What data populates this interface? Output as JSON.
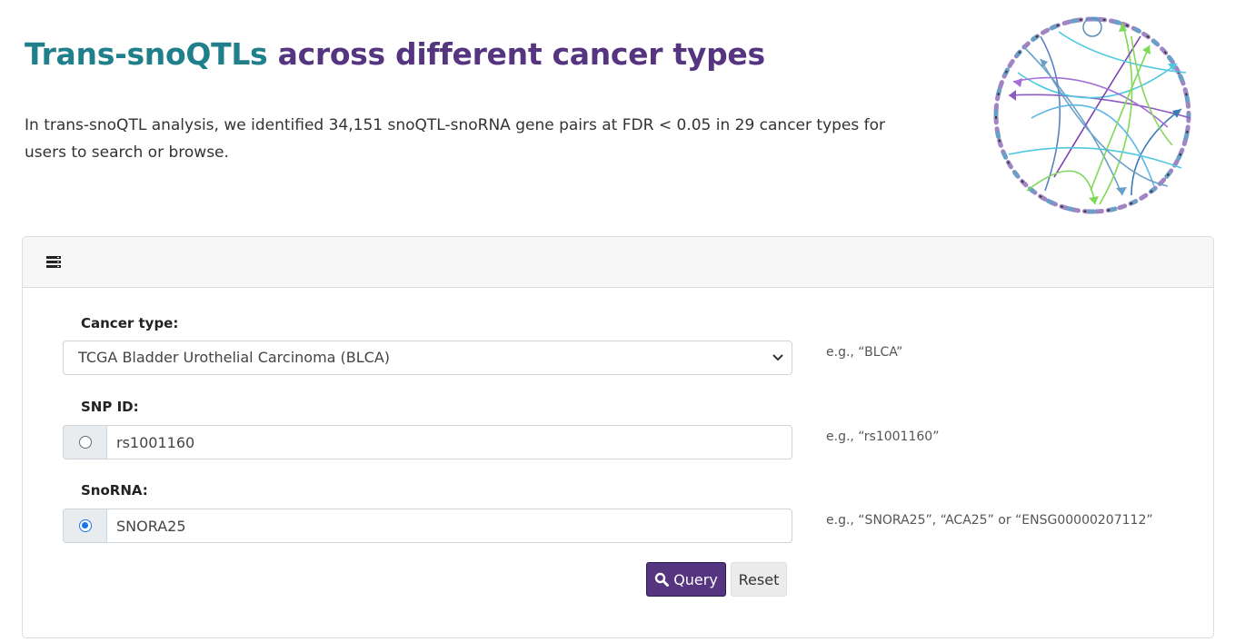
{
  "header": {
    "title_accent": "Trans-snoQTLs",
    "title_rest": "across different cancer types",
    "intro": "In trans-snoQTL analysis, we identified 34,151 snoQTL-snoRNA gene pairs at FDR < 0.05 in 29 cancer types for users to search or browse."
  },
  "logo": {
    "icon": "circos-plot-icon"
  },
  "search_panel": {
    "header_icon": "list-icon",
    "cancer_type": {
      "label": "Cancer type:",
      "selected": "TCGA Bladder Urothelial Carcinoma (BLCA)",
      "hint": "e.g., “BLCA”"
    },
    "snp": {
      "label": "SNP ID:",
      "value": "rs1001160",
      "checked": false,
      "hint": "e.g., “rs1001160”"
    },
    "snorna": {
      "label": "SnoRNA:",
      "value": "SNORA25",
      "checked": true,
      "hint": "e.g., “SNORA25”, “ACA25” or “ENSG00000207112”"
    },
    "buttons": {
      "query": "Query",
      "reset": "Reset"
    }
  },
  "colors": {
    "title_teal": "#1f7f8a",
    "title_purple": "#55357f",
    "query_button": "#55357f",
    "radio_checked": "#1a73e8"
  }
}
